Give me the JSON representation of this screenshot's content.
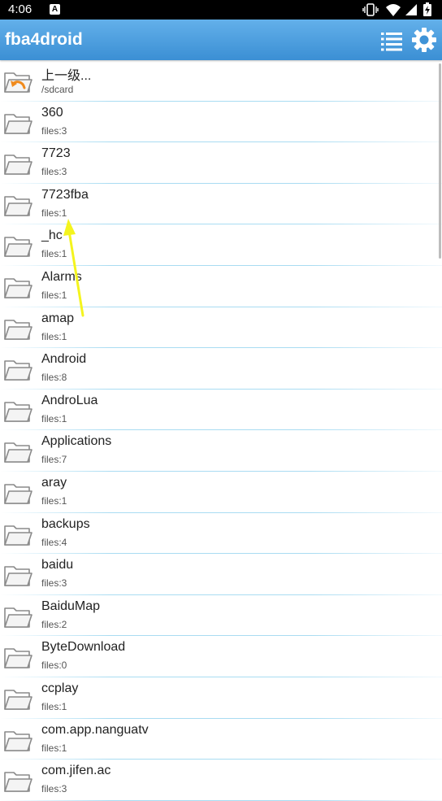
{
  "status_bar": {
    "time": "4:06",
    "notification_letter": "A",
    "icons": [
      "vibrate-icon",
      "wifi-icon",
      "signal-icon",
      "battery-icon"
    ]
  },
  "app_bar": {
    "title": "fba4droid",
    "actions": [
      "list-icon",
      "gear-icon"
    ],
    "color": "#4a9ede"
  },
  "files": [
    {
      "name": "上一级...",
      "meta": "/sdcard",
      "icon": "folder-up-icon"
    },
    {
      "name": "360",
      "meta": "files:3",
      "icon": "folder-icon"
    },
    {
      "name": "7723",
      "meta": "files:3",
      "icon": "folder-icon"
    },
    {
      "name": "7723fba",
      "meta": "files:1",
      "icon": "folder-icon"
    },
    {
      "name": "_hc",
      "meta": "files:1",
      "icon": "folder-icon"
    },
    {
      "name": "Alarms",
      "meta": "files:1",
      "icon": "folder-icon"
    },
    {
      "name": "amap",
      "meta": "files:1",
      "icon": "folder-icon"
    },
    {
      "name": "Android",
      "meta": "files:8",
      "icon": "folder-icon"
    },
    {
      "name": "AndroLua",
      "meta": "files:1",
      "icon": "folder-icon"
    },
    {
      "name": "Applications",
      "meta": "files:7",
      "icon": "folder-icon"
    },
    {
      "name": "aray",
      "meta": "files:1",
      "icon": "folder-icon"
    },
    {
      "name": "backups",
      "meta": "files:4",
      "icon": "folder-icon"
    },
    {
      "name": "baidu",
      "meta": "files:3",
      "icon": "folder-icon"
    },
    {
      "name": "BaiduMap",
      "meta": "files:2",
      "icon": "folder-icon"
    },
    {
      "name": "ByteDownload",
      "meta": "files:0",
      "icon": "folder-icon"
    },
    {
      "name": "ccplay",
      "meta": "files:1",
      "icon": "folder-icon"
    },
    {
      "name": "com.app.nanguatv",
      "meta": "files:1",
      "icon": "folder-icon"
    },
    {
      "name": "com.jifen.ac",
      "meta": "files:3",
      "icon": "folder-icon"
    }
  ],
  "annotation": {
    "color": "#f4f41e"
  }
}
